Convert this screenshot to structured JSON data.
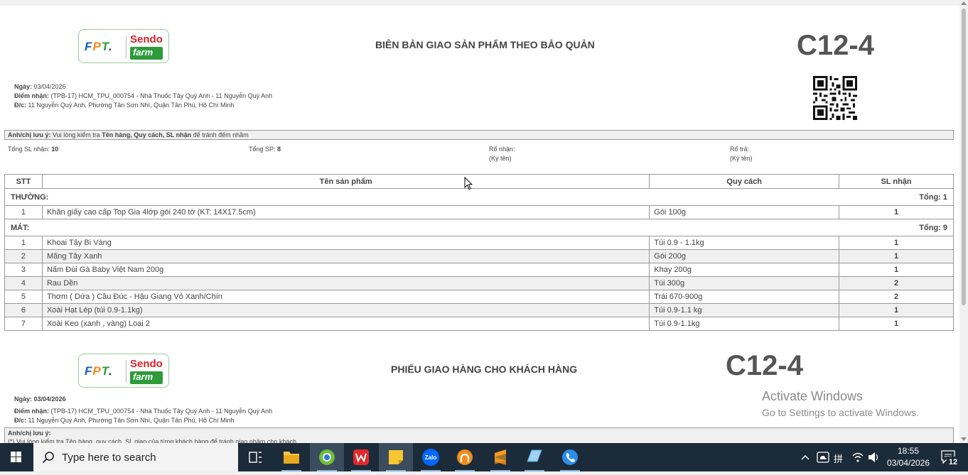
{
  "doc1": {
    "logo": {
      "fpt": "FPT.",
      "sendo": "Sendo",
      "farm": "farm"
    },
    "title": "BIÊN BẢN GIAO SẢN PHẨM THEO BẢO QUẢN",
    "code": "C12-4",
    "date_label": "Ngày:",
    "date_value": "03/04/2026",
    "receiver_label": "Điểm nhận:",
    "receiver_value": "(TPB-17) HCM_TPU_000754 - Nhà Thuốc Tây Quý Anh - 11 Nguyễn Quý Anh",
    "address_label": "Đ/c:",
    "address_value": "11 Nguyễn Quý Anh, Phường Tân Sơn Nhì, Quận Tân Phú, Hồ Chí Minh",
    "note_label": "Anh/chị lưu ý:",
    "note_pre": "Vui lòng kiểm tra",
    "note_bold": "Tên hàng, Quy cách, SL nhận",
    "note_post": "để tránh đếm nhầm",
    "total_qty_label": "Tổng SL nhận:",
    "total_qty_value": "10",
    "total_sp_label": "Tổng SP:",
    "total_sp_value": "8",
    "ro_nhan": "Rổ nhận:",
    "ro_tra": "Rổ trả:",
    "sign_hint": "(Ký tên)",
    "headers": {
      "stt": "STT",
      "name": "Tên sản phẩm",
      "spec": "Quy cách",
      "qty": "SL nhận"
    },
    "groups": [
      {
        "name": "THƯỜNG:",
        "total": "Tổng: 1",
        "rows": [
          {
            "stt": "1",
            "name": "Khăn giấy cao cấp Top Gia 4lớp gói 240 tờ (KT: 14X17.5cm)",
            "spec": "Gói 100g",
            "qty": "1"
          }
        ]
      },
      {
        "name": "MÁT:",
        "total": "Tổng: 9",
        "rows": [
          {
            "stt": "1",
            "name": "Khoai Tây Bi Vàng",
            "spec": "Túi 0.9 - 1.1kg",
            "qty": "1"
          },
          {
            "stt": "2",
            "name": "Măng Tây Xanh",
            "spec": "Gói 200g",
            "qty": "1"
          },
          {
            "stt": "3",
            "name": "Nấm Đùi Gà Baby Việt Nam 200g",
            "spec": "Khay 200g",
            "qty": "1"
          },
          {
            "stt": "4",
            "name": "Rau Dền",
            "spec": "Túi 300g",
            "qty": "2"
          },
          {
            "stt": "5",
            "name": "Thơm ( Dứa ) Cầu Đúc - Hậu Giang Vỏ Xanh/Chín",
            "spec": "Trái 670-900g",
            "qty": "2"
          },
          {
            "stt": "6",
            "name": "Xoài Hạt Lép (túi 0.9-1.1kg)",
            "spec": "Túi 0.9-1.1 kg",
            "qty": "1"
          },
          {
            "stt": "7",
            "name": "Xoài Keo (xanh , vàng) Loại 2",
            "spec": "Túi 0.9-1.1kg",
            "qty": "1"
          }
        ]
      }
    ]
  },
  "doc2": {
    "title": "PHIẾU GIAO HÀNG CHO KHÁCH HÀNG",
    "code": "C12-4",
    "date_label": "Ngày:",
    "date_value": "03/04/2026",
    "receiver_label": "Điểm nhận:",
    "receiver_value": "(TPB-17) HCM_TPU_000754 - Nhà Thuốc Tây Quý Anh - 11 Nguyễn Quý Anh",
    "address_label": "Đ/c:",
    "address_value": "11 Nguyễn Quý Anh, Phường Tân Sơn Nhì, Quận Tân Phú, Hồ Chí Minh",
    "note_label": "Anh/chị lưu ý:",
    "note_line2": "(*) Vui lòng kiểm tra Tên hàng, quy cách, SL giao của từng khách hàng để tránh giao nhầm cho khách"
  },
  "watermark": {
    "line1": "Activate Windows",
    "line2": "Go to Settings to activate Windows."
  },
  "taskbar": {
    "search_placeholder": "Type here to search",
    "time": "18:55",
    "date": "03/04/2026",
    "lang": "拼",
    "notification_count": "12"
  },
  "colors": {
    "taskbar": "#1c2b3a",
    "zalo": "#0068ff",
    "wps": "#e02a2a",
    "sticky": "#f7c631"
  }
}
